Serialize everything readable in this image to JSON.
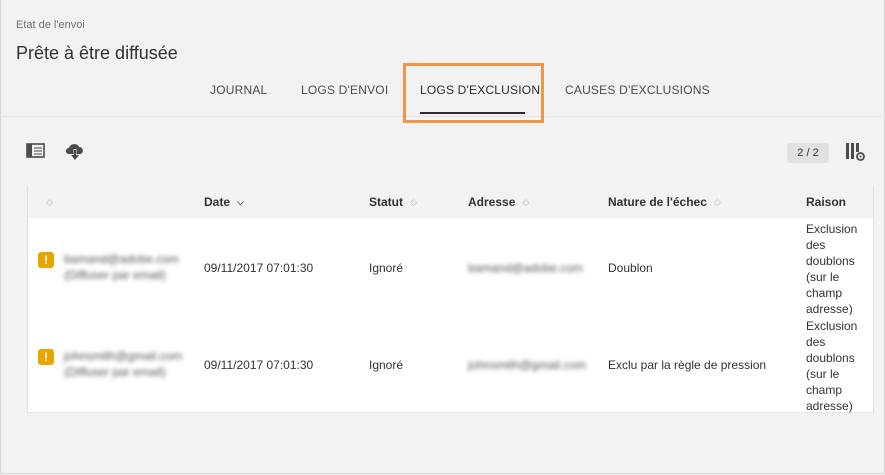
{
  "header": {
    "breadcrumb": "Etat de l'envoi",
    "title": "Prête à être diffusée"
  },
  "tabs": [
    {
      "label": "JOURNAL",
      "active": false
    },
    {
      "label": "LOGS D'ENVOI",
      "active": false
    },
    {
      "label": "LOGS D'EXCLUSION",
      "active": true
    },
    {
      "label": "CAUSES D'EXCLUSIONS",
      "active": false
    }
  ],
  "toolbar": {
    "panel_icon": "panel-toggle-icon",
    "download_icon": "cloud-download-icon",
    "columns_icon": "column-settings-icon",
    "pager": "2 / 2"
  },
  "table": {
    "columns": [
      {
        "label": ""
      },
      {
        "label": "Date"
      },
      {
        "label": "Statut"
      },
      {
        "label": "Adresse"
      },
      {
        "label": "Nature de l'échec"
      },
      {
        "label": "Raison"
      }
    ],
    "rows": [
      {
        "recipient_line1": "bamand@adobe.com",
        "recipient_line2": "(Diffuser par email)",
        "date": "09/11/2017 07:01:30",
        "status": "Ignoré",
        "address": "bamand@adobe.com",
        "failure_nature": "Doublon",
        "reason": "Exclusion des doublons (sur le champ adresse)"
      },
      {
        "recipient_line1": "johnsmith@gmail.com",
        "recipient_line2": "(Diffuser par email)",
        "date": "09/11/2017 07:01:30",
        "status": "Ignoré",
        "address": "johnsmith@gmail.com",
        "failure_nature": "Exclu par la règle de pression",
        "reason": "Exclusion des doublons (sur le champ adresse)"
      }
    ]
  },
  "colors": {
    "highlight": "#f0954a",
    "warning": "#e8a500"
  }
}
